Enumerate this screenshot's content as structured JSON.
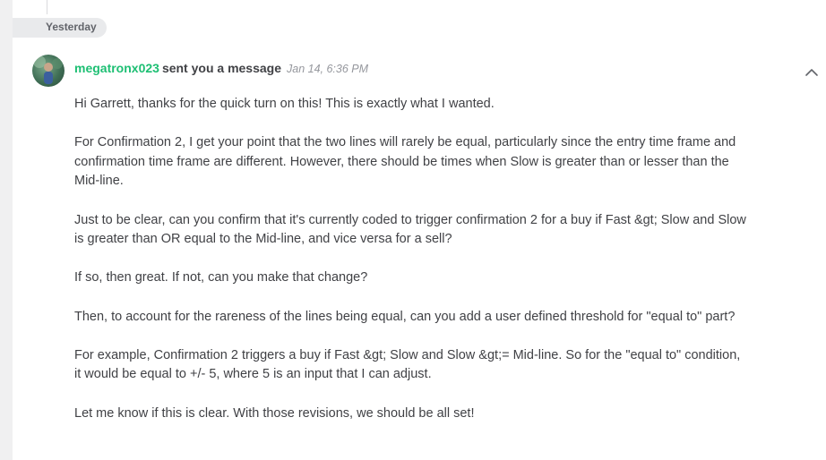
{
  "date_divider": "Yesterday",
  "message": {
    "sender": "megatronx023",
    "action": "sent you a message",
    "timestamp": "Jan 14, 6:36 PM",
    "paragraphs": [
      "Hi Garrett, thanks for the quick turn on this! This is exactly what I wanted.",
      "For Confirmation 2, I get your point that the two lines will rarely be equal, particularly since the entry time frame and confirmation time frame are different. However, there should be times when Slow is greater than or lesser than the Mid-line.",
      "Just to be clear, can you confirm that it's currently coded to trigger confirmation 2 for a buy if Fast &gt; Slow and Slow is greater than OR equal to the Mid-line, and vice versa for a sell?",
      "If so, then great. If not, can you make that change?",
      "Then, to account for the rareness of the lines being equal, can you add a user defined threshold for \"equal to\" part?",
      "For example, Confirmation 2 triggers a buy if Fast &gt; Slow and Slow &gt;= Mid-line. So for the \"equal to\" condition, it would be equal to +/- 5, where 5 is an input that I can adjust.",
      "Let me know if this is clear. With those revisions, we should be all set!"
    ]
  },
  "icons": {
    "avatar": "user-avatar-photo",
    "collapse": "chevron-up-icon"
  },
  "colors": {
    "sender": "#1dbf73",
    "text": "#404145",
    "timestamp": "#95979d",
    "divider_bg": "#e9eaec"
  }
}
